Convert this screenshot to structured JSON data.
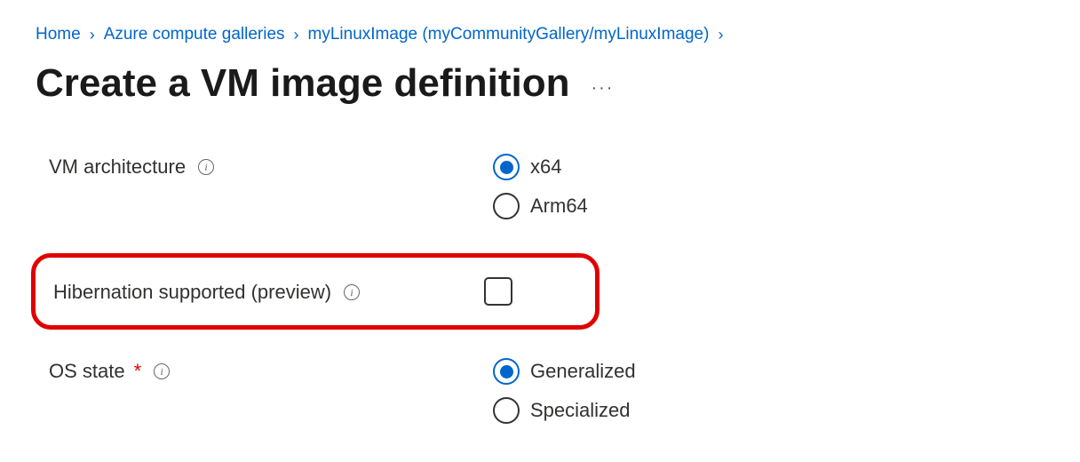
{
  "breadcrumb": {
    "home": "Home",
    "galleries": "Azure compute galleries",
    "image": "myLinuxImage (myCommunityGallery/myLinuxImage)"
  },
  "page": {
    "title": "Create a VM image definition"
  },
  "form": {
    "vmArch": {
      "label": "VM architecture",
      "options": {
        "x64": "x64",
        "arm64": "Arm64"
      }
    },
    "hibernation": {
      "label": "Hibernation supported (preview)"
    },
    "osState": {
      "label": "OS state",
      "options": {
        "generalized": "Generalized",
        "specialized": "Specialized"
      }
    }
  }
}
